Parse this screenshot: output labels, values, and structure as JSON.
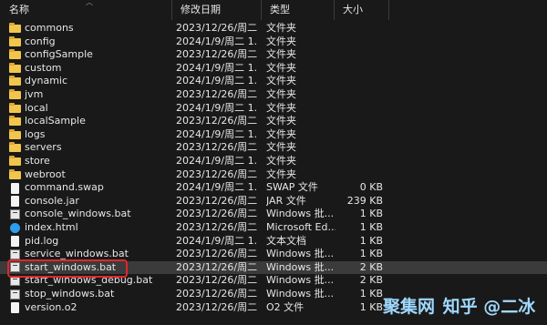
{
  "columns": {
    "name": "名称",
    "date": "修改日期",
    "type": "类型",
    "size": "大小"
  },
  "files": [
    {
      "name": "commons",
      "date": "2023/12/26/周二 1...",
      "type": "文件夹",
      "size": "",
      "icon": "folder-icon"
    },
    {
      "name": "config",
      "date": "2024/1/9/周二 1...",
      "type": "文件夹",
      "size": "",
      "icon": "folder-icon"
    },
    {
      "name": "configSample",
      "date": "2023/12/26/周二 1...",
      "type": "文件夹",
      "size": "",
      "icon": "folder-icon"
    },
    {
      "name": "custom",
      "date": "2024/1/9/周二 1...",
      "type": "文件夹",
      "size": "",
      "icon": "folder-icon"
    },
    {
      "name": "dynamic",
      "date": "2024/1/9/周二 1...",
      "type": "文件夹",
      "size": "",
      "icon": "folder-icon"
    },
    {
      "name": "jvm",
      "date": "2023/12/26/周二 1...",
      "type": "文件夹",
      "size": "",
      "icon": "folder-icon"
    },
    {
      "name": "local",
      "date": "2024/1/9/周二 1...",
      "type": "文件夹",
      "size": "",
      "icon": "folder-icon"
    },
    {
      "name": "localSample",
      "date": "2023/12/26/周二 1...",
      "type": "文件夹",
      "size": "",
      "icon": "folder-icon"
    },
    {
      "name": "logs",
      "date": "2024/1/9/周二 1...",
      "type": "文件夹",
      "size": "",
      "icon": "folder-icon"
    },
    {
      "name": "servers",
      "date": "2023/12/26/周二 1...",
      "type": "文件夹",
      "size": "",
      "icon": "folder-icon"
    },
    {
      "name": "store",
      "date": "2024/1/9/周二 1...",
      "type": "文件夹",
      "size": "",
      "icon": "folder-icon"
    },
    {
      "name": "webroot",
      "date": "2023/12/26/周二 1...",
      "type": "文件夹",
      "size": "",
      "icon": "folder-icon"
    },
    {
      "name": "command.swap",
      "date": "2024/1/9/周二 1...",
      "type": "SWAP 文件",
      "size": "0 KB",
      "icon": "file-icon"
    },
    {
      "name": "console.jar",
      "date": "2023/12/26/周二...",
      "type": "JAR 文件",
      "size": "239 KB",
      "icon": "file-icon"
    },
    {
      "name": "console_windows.bat",
      "date": "2023/12/26/周二...",
      "type": "Windows 批...",
      "size": "1 KB",
      "icon": "bat-icon"
    },
    {
      "name": "index.html",
      "date": "2023/12/26/周二...",
      "type": "Microsoft Ed...",
      "size": "1 KB",
      "icon": "edge-icon"
    },
    {
      "name": "pid.log",
      "date": "2024/1/9/周二 1...",
      "type": "文本文档",
      "size": "1 KB",
      "icon": "log-icon"
    },
    {
      "name": "service_windows.bat",
      "date": "2023/12/26/周二...",
      "type": "Windows 批...",
      "size": "1 KB",
      "icon": "bat-icon"
    },
    {
      "name": "start_windows.bat",
      "date": "2023/12/26/周二...",
      "type": "Windows 批...",
      "size": "2 KB",
      "icon": "bat-icon",
      "selected": true
    },
    {
      "name": "start_windows_debug.bat",
      "date": "2023/12/26/周二...",
      "type": "Windows 批...",
      "size": "2 KB",
      "icon": "bat-icon"
    },
    {
      "name": "stop_windows.bat",
      "date": "2023/12/26/周二...",
      "type": "Windows 批...",
      "size": "1 KB",
      "icon": "bat-icon"
    },
    {
      "name": "version.o2",
      "date": "2023/12/26/周二...",
      "type": "O2 文件",
      "size": "1 KB",
      "icon": "file-icon"
    }
  ],
  "watermark": {
    "logo": "聚集网",
    "brand": "知乎 @二冰"
  },
  "colors": {
    "background": "#191919",
    "selected_row": "#3b3b3b",
    "highlight_border": "#e0262a",
    "folder": "#f2c64c"
  }
}
